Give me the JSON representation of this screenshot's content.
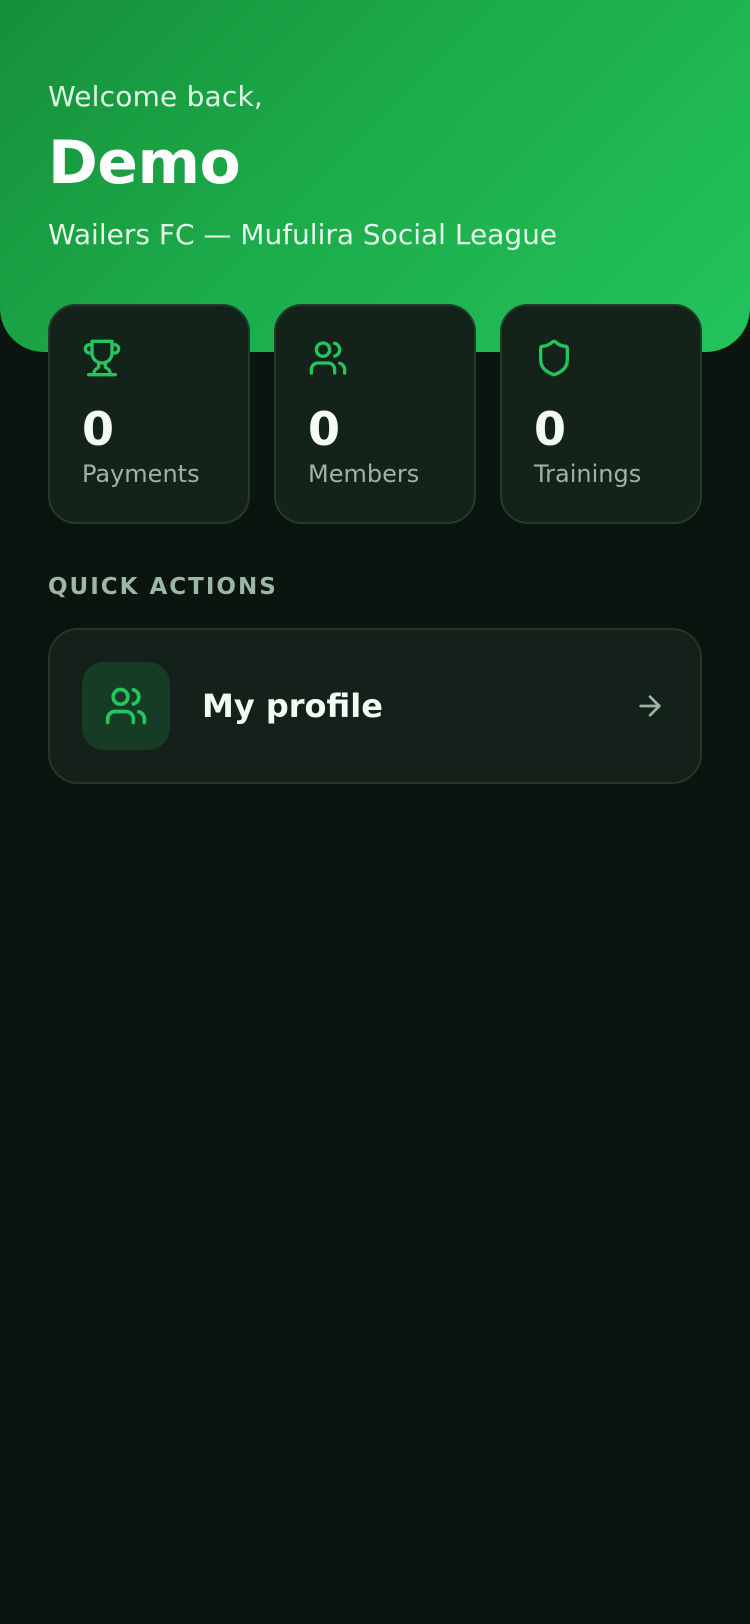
{
  "header": {
    "greeting": "Welcome back,",
    "user_name": "Demo",
    "club": "Wailers FC — Mufulira Social League"
  },
  "stats": [
    {
      "icon": "trophy-icon",
      "value": "0",
      "label": "Payments"
    },
    {
      "icon": "users-icon",
      "value": "0",
      "label": "Members"
    },
    {
      "icon": "shield-icon",
      "value": "0",
      "label": "Trainings"
    }
  ],
  "quick_actions": {
    "title": "QUICK ACTIONS",
    "items": [
      {
        "icon": "users-icon",
        "label": "My profile",
        "trailing_icon": "arrow-right-icon"
      }
    ]
  },
  "colors": {
    "accent": "#22c55e",
    "background": "#0c140f",
    "card": "#14231a",
    "muted_text": "#9fb3a5"
  }
}
